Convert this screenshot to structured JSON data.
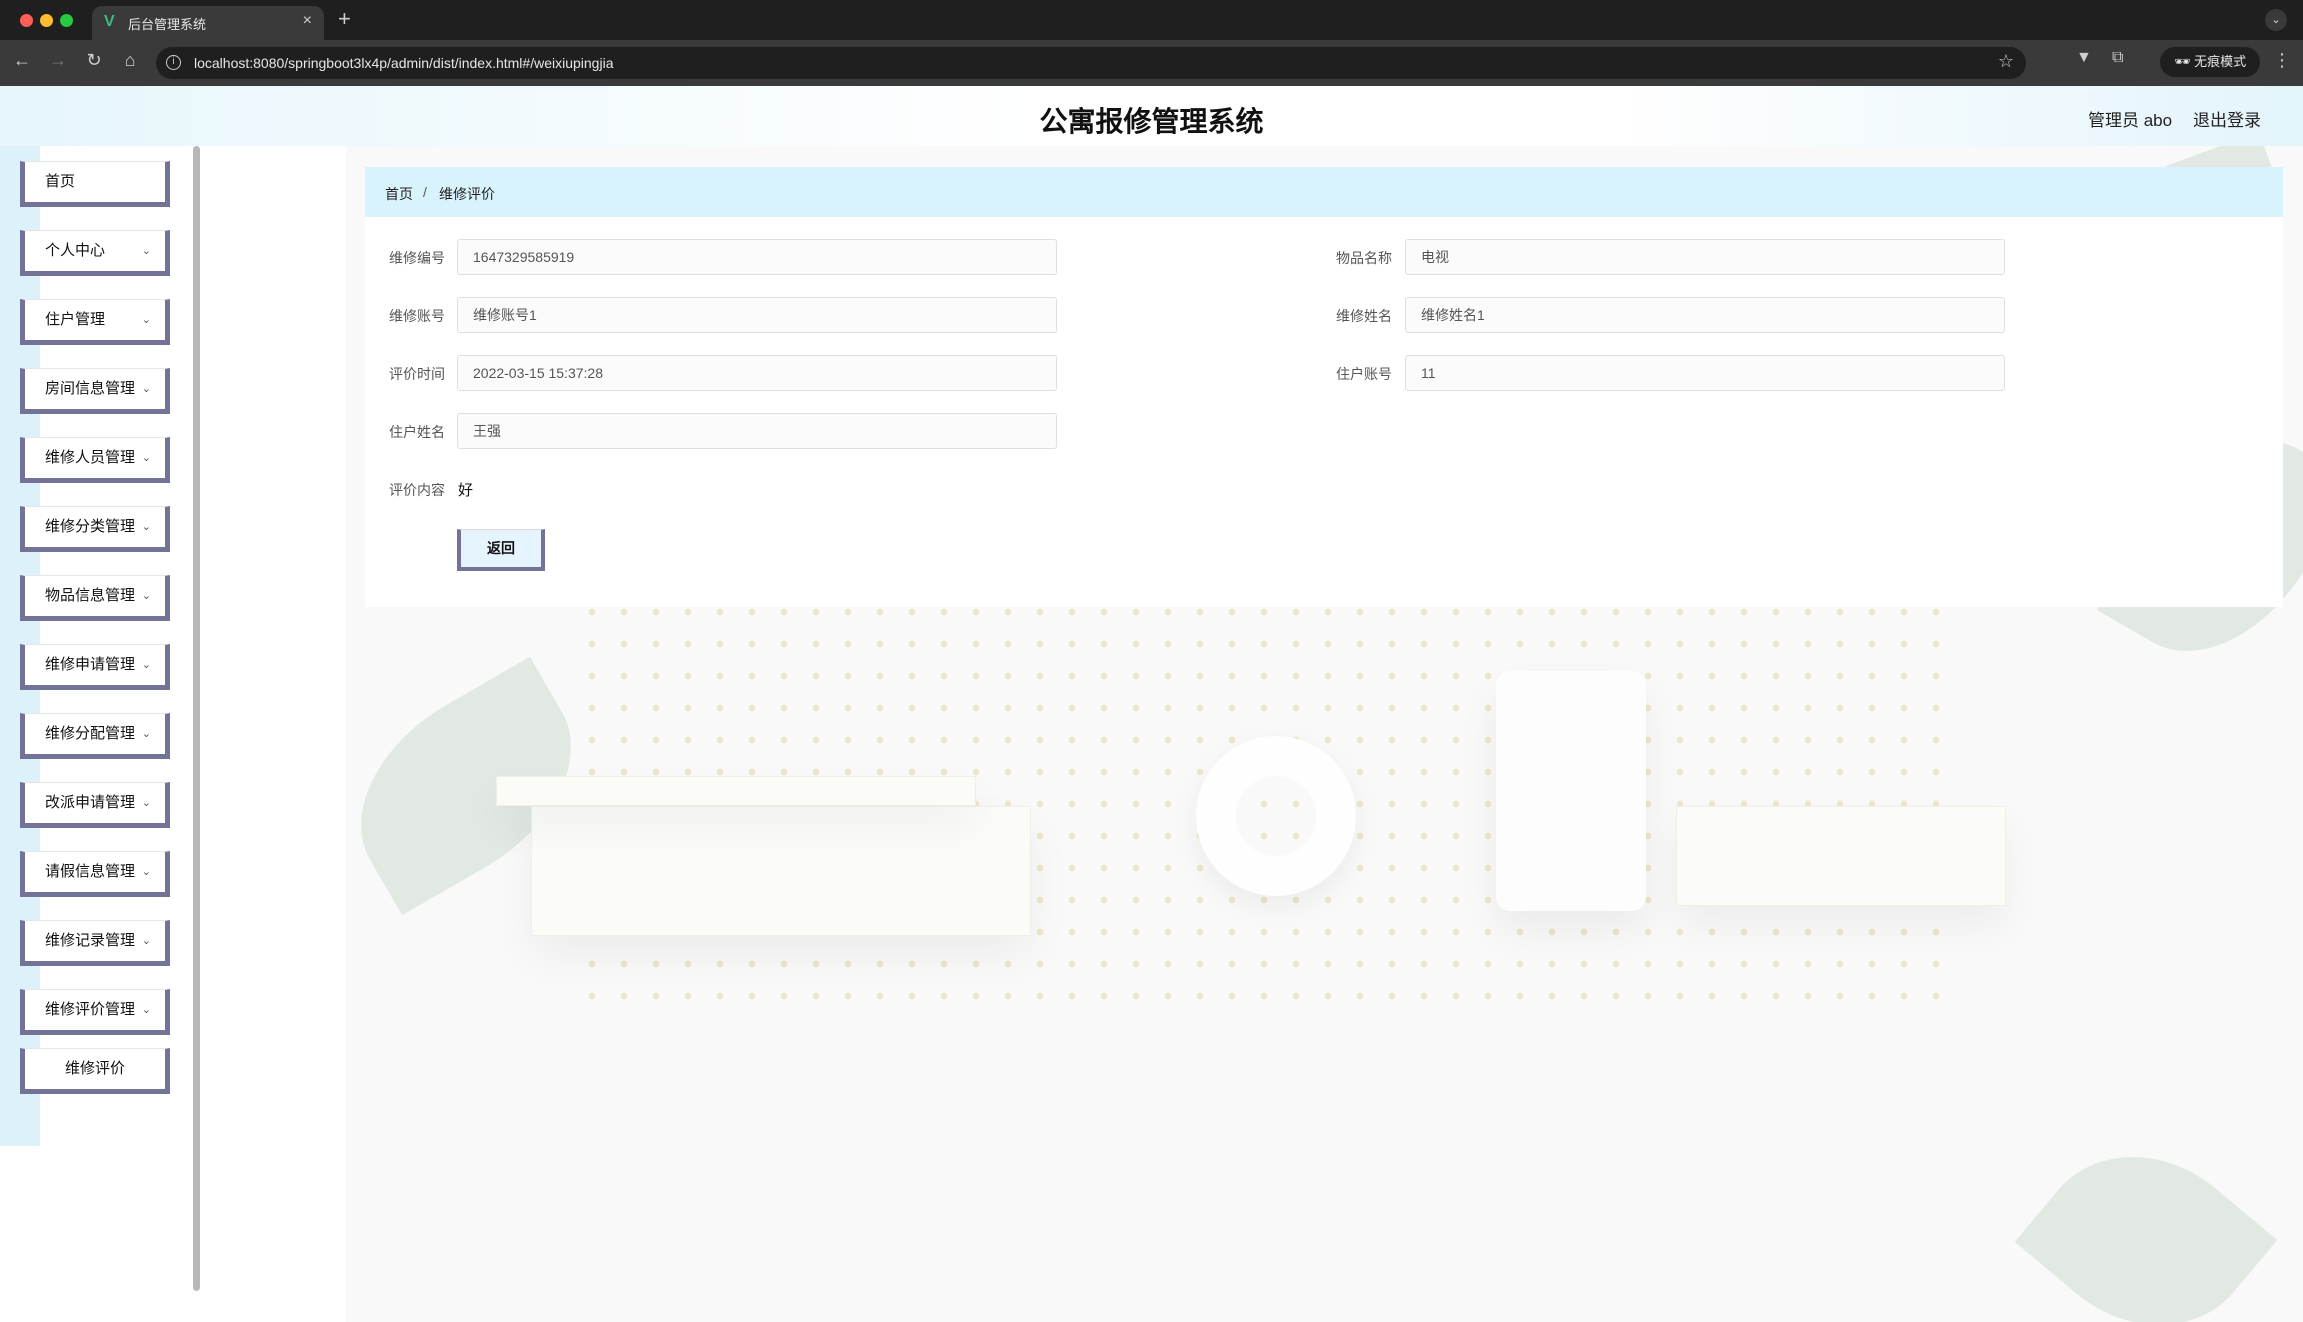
{
  "browser": {
    "tab_title": "后台管理系统",
    "tab_favicon": "V",
    "url": "localhost:8080/springboot3lx4p/admin/dist/index.html#/weixiupingjia",
    "incognito_label": "无痕模式"
  },
  "header": {
    "title": "公寓报修管理系统",
    "user_label": "管理员 abo",
    "logout_label": "退出登录"
  },
  "sidebar": {
    "items": [
      {
        "label": "首页",
        "expandable": false
      },
      {
        "label": "个人中心",
        "expandable": true
      },
      {
        "label": "住户管理",
        "expandable": true
      },
      {
        "label": "房间信息管理",
        "expandable": true
      },
      {
        "label": "维修人员管理",
        "expandable": true
      },
      {
        "label": "维修分类管理",
        "expandable": true
      },
      {
        "label": "物品信息管理",
        "expandable": true
      },
      {
        "label": "维修申请管理",
        "expandable": true
      },
      {
        "label": "维修分配管理",
        "expandable": true
      },
      {
        "label": "改派申请管理",
        "expandable": true
      },
      {
        "label": "请假信息管理",
        "expandable": true
      },
      {
        "label": "维修记录管理",
        "expandable": true
      },
      {
        "label": "维修评价管理",
        "expandable": true
      }
    ],
    "submenu_item": "维修评价"
  },
  "breadcrumb": {
    "home": "首页",
    "separator": "/",
    "current": "维修评价"
  },
  "form": {
    "repair_no": {
      "label": "维修编号",
      "value": "1647329585919"
    },
    "item_name": {
      "label": "物品名称",
      "value": "电视"
    },
    "repair_account": {
      "label": "维修账号",
      "value": "维修账号1"
    },
    "repair_name": {
      "label": "维修姓名",
      "value": "维修姓名1"
    },
    "review_time": {
      "label": "评价时间",
      "value": "2022-03-15 15:37:28"
    },
    "resident_account": {
      "label": "住户账号",
      "value": "11"
    },
    "resident_name": {
      "label": "住户姓名",
      "value": "王强"
    },
    "review_content": {
      "label": "评价内容",
      "value": "好"
    },
    "back_button": "返回"
  },
  "colors": {
    "accent_border": "#727397",
    "breadcrumb_bg": "#d9f3fc",
    "sidebar_strip": "#dcf1fa"
  }
}
